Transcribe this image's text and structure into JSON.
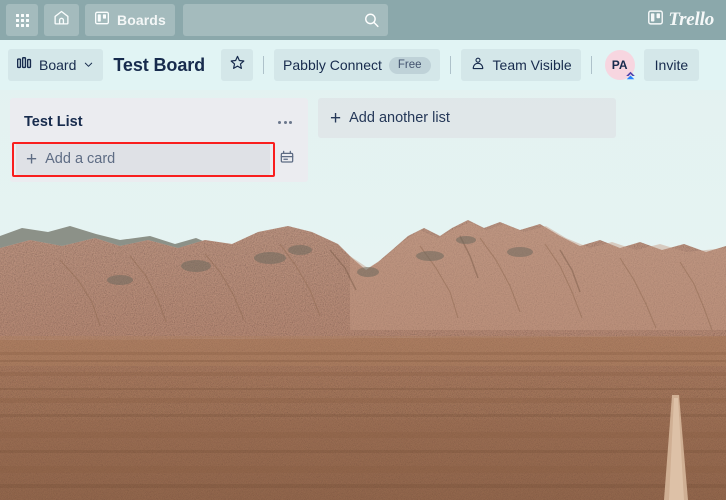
{
  "topnav": {
    "apps_icon": "grid-apps-icon",
    "home_icon": "home-icon",
    "boards_icon": "boards-icon",
    "boards_label": "Boards",
    "search_value": "",
    "search_placeholder": "",
    "search_icon": "search-icon",
    "logo_icon": "trello-logo-icon",
    "logo_text": "Trello"
  },
  "boardbar": {
    "view_icon": "board-view-icon",
    "view_label": "Board",
    "view_chevron": "chevron-down-icon",
    "title": "Test Board",
    "star_icon": "star-icon",
    "workspace_label": "Pabbly Connect",
    "workspace_plan": "Free",
    "visibility_icon": "team-visibility-icon",
    "visibility_label": "Team Visible",
    "avatar_initials": "PA",
    "avatar_badge_icon": "atlassian-badge-icon",
    "invite_label": "Invite"
  },
  "board": {
    "lists": [
      {
        "title": "Test List",
        "menu_icon": "list-menu-icon",
        "add_card_label": "Add a card",
        "add_card_plus": "+",
        "template_icon": "card-template-icon"
      }
    ],
    "add_list_label": "Add another list",
    "add_list_plus": "+"
  },
  "annotation": {
    "highlight_color": "#f91e1e",
    "target": "add-a-card-button"
  },
  "colors": {
    "topbar": "#8ba8ab",
    "board_header": "#e1f4f4",
    "canvas_bg": "#e4f4f4",
    "list_bg": "#ebecf0",
    "text_dark": "#172b4d",
    "avatar_bg": "#f7d6e0"
  }
}
